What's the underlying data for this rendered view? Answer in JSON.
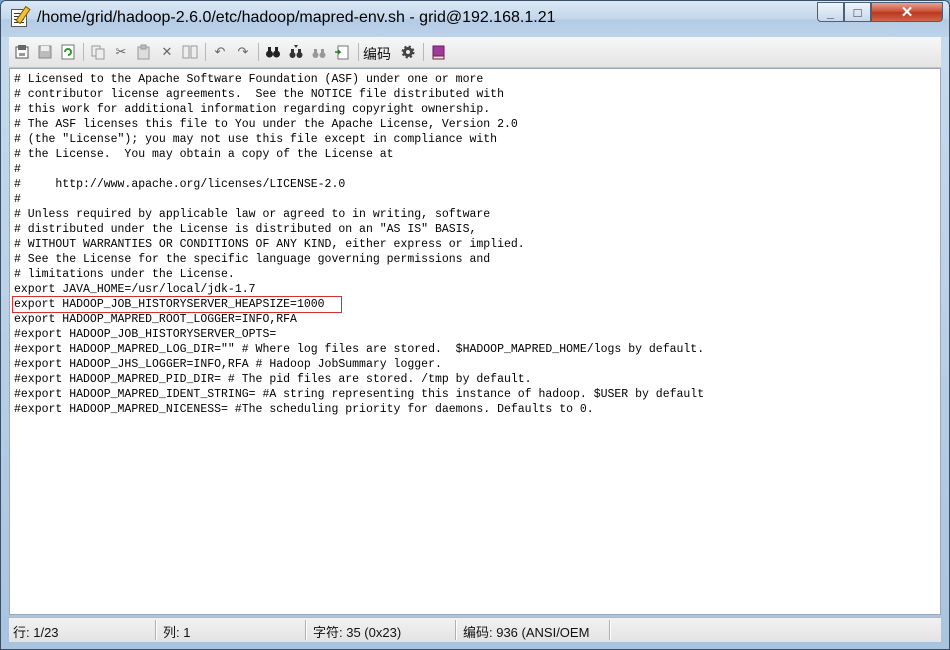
{
  "window": {
    "title": "/home/grid/hadoop-2.6.0/etc/hadoop/mapred-env.sh - grid@192.168.1.21",
    "controls": {
      "minimize": "_",
      "maximize": "□",
      "close": "✕"
    }
  },
  "toolbar": {
    "icons": [
      "open-icon",
      "save-icon",
      "reload-icon",
      "copy-icon",
      "cut-icon",
      "paste-icon",
      "delete-icon",
      "find-replace-icon",
      "undo-icon",
      "redo-icon",
      "find-icon",
      "find-next-icon",
      "find-prev-icon",
      "goto-line-icon",
      "settings-icon",
      "help-book-icon"
    ],
    "encoding_label": "编码"
  },
  "editor": {
    "highlighted_line_index": 15,
    "highlight_color": "#d43030",
    "lines": [
      "# Licensed to the Apache Software Foundation (ASF) under one or more",
      "# contributor license agreements.  See the NOTICE file distributed with",
      "# this work for additional information regarding copyright ownership.",
      "# The ASF licenses this file to You under the Apache License, Version 2.0",
      "# (the \"License\"); you may not use this file except in compliance with",
      "# the License.  You may obtain a copy of the License at",
      "#",
      "#     http://www.apache.org/licenses/LICENSE-2.0",
      "#",
      "# Unless required by applicable law or agreed to in writing, software",
      "# distributed under the License is distributed on an \"AS IS\" BASIS,",
      "# WITHOUT WARRANTIES OR CONDITIONS OF ANY KIND, either express or implied.",
      "# See the License for the specific language governing permissions and",
      "# limitations under the License.",
      "export JAVA_HOME=/usr/local/jdk-1.7",
      "export HADOOP_JOB_HISTORYSERVER_HEAPSIZE=1000",
      "export HADOOP_MAPRED_ROOT_LOGGER=INFO,RFA",
      "#export HADOOP_JOB_HISTORYSERVER_OPTS=",
      "#export HADOOP_MAPRED_LOG_DIR=\"\" # Where log files are stored.  $HADOOP_MAPRED_HOME/logs by default.",
      "#export HADOOP_JHS_LOGGER=INFO,RFA # Hadoop JobSummary logger.",
      "#export HADOOP_MAPRED_PID_DIR= # The pid files are stored. /tmp by default.",
      "#export HADOOP_MAPRED_IDENT_STRING= #A string representing this instance of hadoop. $USER by default",
      "#export HADOOP_MAPRED_NICENESS= #The scheduling priority for daemons. Defaults to 0."
    ]
  },
  "status": {
    "line": "行: 1/23",
    "col": "列: 1",
    "chars": "字符: 35 (0x23)",
    "encoding": "编码: 936  (ANSI/OEM"
  }
}
